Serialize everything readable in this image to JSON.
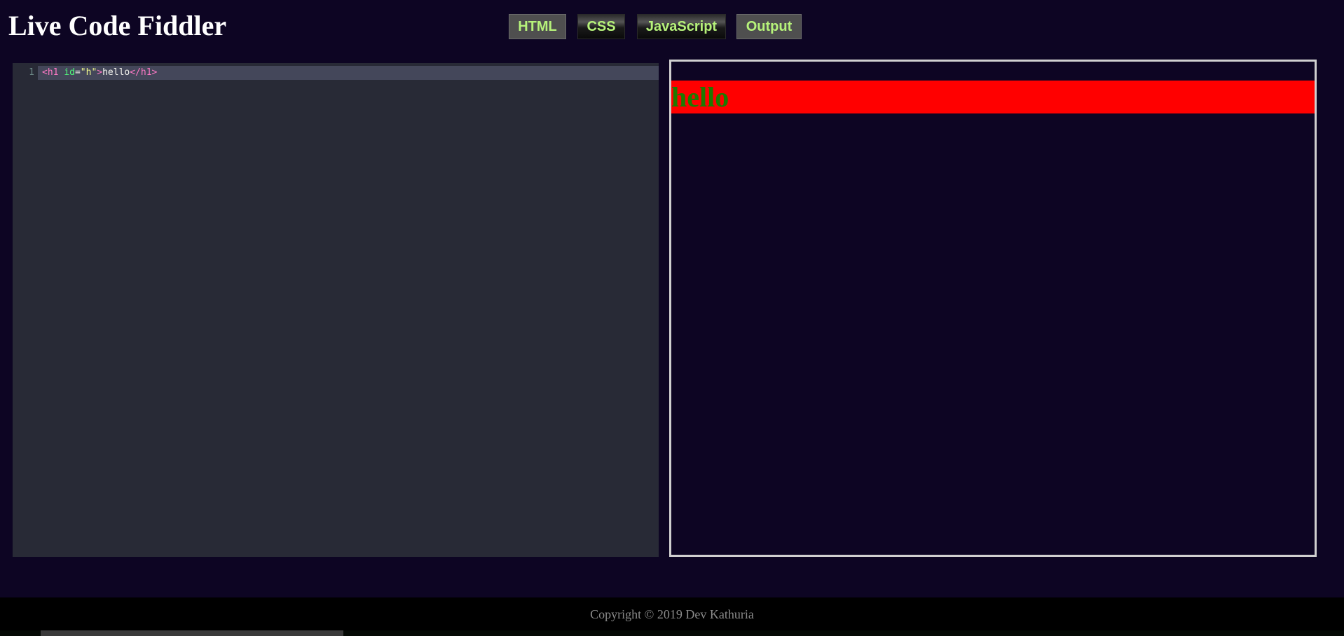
{
  "header": {
    "title": "Live Code Fiddler"
  },
  "tabs": [
    {
      "label": "HTML",
      "active": true
    },
    {
      "label": "CSS",
      "active": false
    },
    {
      "label": "JavaScript",
      "active": false
    },
    {
      "label": "Output",
      "active": true
    }
  ],
  "editor": {
    "lines": [
      {
        "number": "1",
        "tokens": {
          "open_tag": "<h1",
          "attr_name": "id",
          "equals": "=",
          "attr_value": "\"h\"",
          "open_close": ">",
          "text": "hello",
          "close_tag": "</h1>"
        }
      }
    ]
  },
  "output": {
    "heading_text": "hello",
    "heading_bg": "#ff0000",
    "heading_color": "#1d7a00"
  },
  "footer": {
    "copyright": "Copyright © 2019 Dev Kathuria"
  },
  "colors": {
    "background": "#0d0523",
    "tab_text": "#b6f27a",
    "editor_bg": "#282a36"
  }
}
